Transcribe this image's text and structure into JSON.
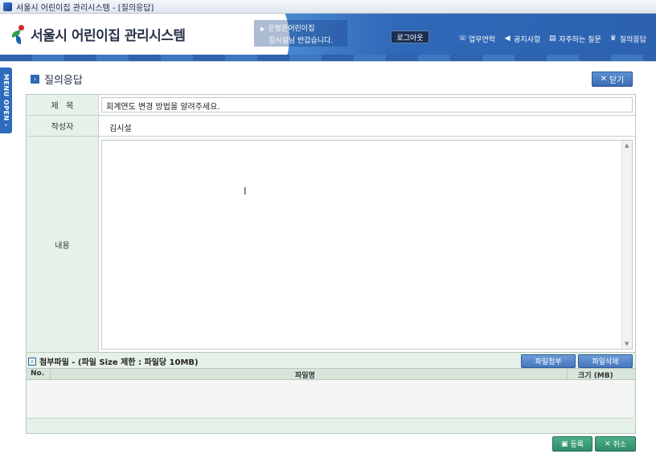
{
  "window": {
    "title": "서울시 어린이집 관리시스템 - [질의응답]"
  },
  "header": {
    "logo_text": "서울시 어린이집 관리시스템",
    "user_line1": "은평온어린이집",
    "user_line2": "김시설님 반갑습니다.",
    "logout_label": "로그아웃",
    "nav": [
      {
        "label": "업무연락",
        "icon": "contact-icon"
      },
      {
        "label": "공지사항",
        "icon": "speaker-icon"
      },
      {
        "label": "자주하는 질문",
        "icon": "document-icon"
      },
      {
        "label": "질의응답",
        "icon": "qna-icon"
      }
    ]
  },
  "side_menu": {
    "label": "MENU OPEN ›"
  },
  "page": {
    "title": "질의응답",
    "close_label": "닫기"
  },
  "form": {
    "title_label": "제   목",
    "title_value": "회계연도 변경 방법을 알려주세요.",
    "author_label": "작성자",
    "author_value": "김시설",
    "content_label": "내용",
    "content_value": ""
  },
  "attachments": {
    "title": "첨부파일 - (파일 Size 제한 : 파일당 10MB)",
    "attach_label": "파일첨부",
    "delete_label": "파일삭제",
    "columns": [
      "No.",
      "파일명",
      "크기 (MB)"
    ],
    "rows": []
  },
  "actions": {
    "submit_label": "등록",
    "cancel_label": "취소"
  }
}
